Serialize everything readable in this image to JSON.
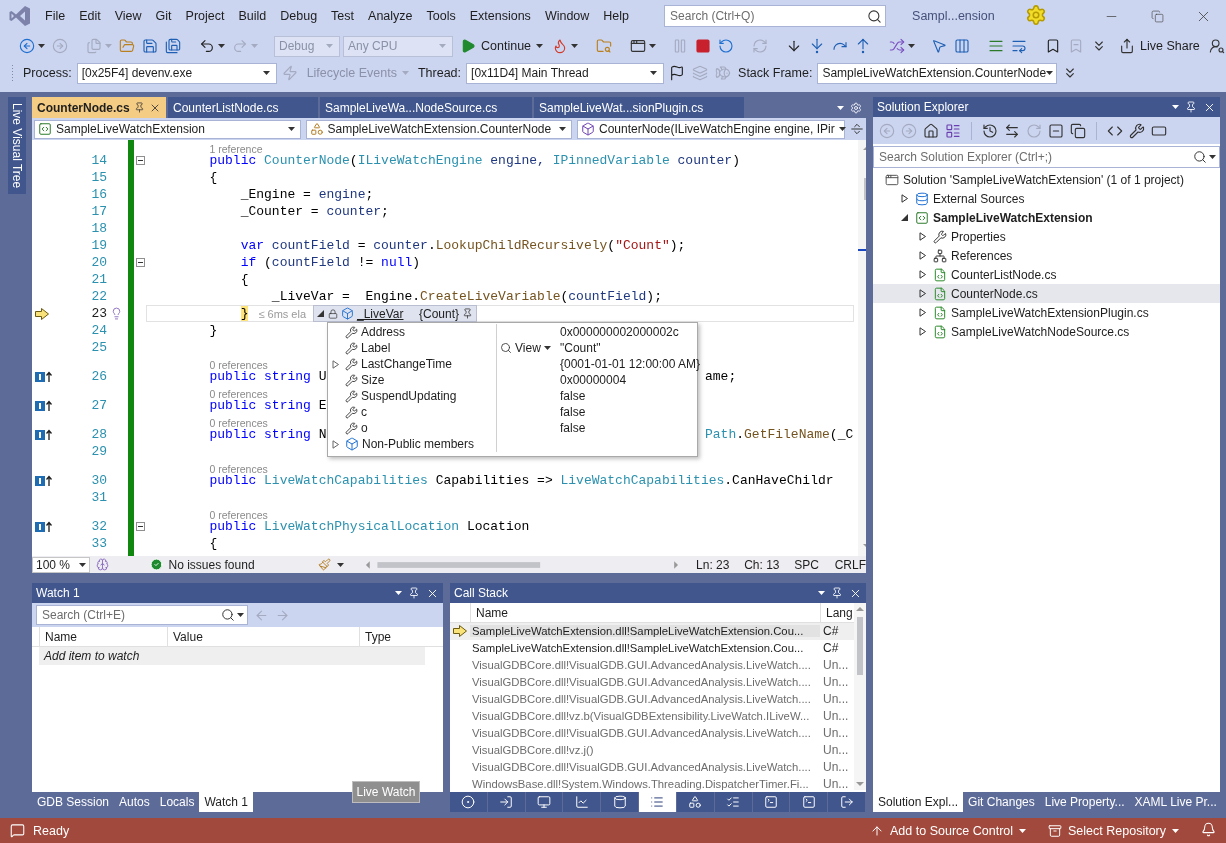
{
  "title_bar": {
    "menu": [
      "File",
      "Edit",
      "View",
      "Git",
      "Project",
      "Build",
      "Debug",
      "Test",
      "Analyze",
      "Tools",
      "Extensions",
      "Window",
      "Help"
    ],
    "search": {
      "placeholder": "Search (Ctrl+Q)"
    },
    "title": "Sampl...ension"
  },
  "toolbar": [
    {
      "kind": "back",
      "menu": true,
      "disabled": false
    },
    {
      "kind": "forward",
      "menu": false,
      "disabled": true
    },
    {
      "kind": "separator"
    },
    {
      "kind": "new",
      "menu": true,
      "disabled": true
    },
    {
      "kind": "open",
      "menu": false,
      "disabled": false
    },
    {
      "kind": "save",
      "menu": false,
      "disabled": false
    },
    {
      "kind": "save_all",
      "menu": false,
      "disabled": false
    },
    {
      "kind": "separator"
    },
    {
      "kind": "undo",
      "menu": true,
      "disabled": false
    },
    {
      "kind": "redo",
      "menu": true,
      "disabled": true
    },
    {
      "kind": "separator"
    },
    {
      "kind": "combo",
      "value": "Debug",
      "disabled": true
    },
    {
      "kind": "combo",
      "value": "Any CPU",
      "disabled": true
    },
    {
      "kind": "run_button",
      "label": "Continue",
      "menu": true,
      "disabled": false
    },
    {
      "kind": "hot_reload",
      "menu": true,
      "disabled": false
    },
    {
      "kind": "separator"
    },
    {
      "kind": "folder_search",
      "menu": false,
      "disabled": false
    },
    {
      "kind": "separator"
    },
    {
      "kind": "window_layout",
      "menu": true,
      "disabled": false
    },
    {
      "kind": "grip"
    },
    {
      "kind": "pause",
      "menu": false,
      "disabled": true
    },
    {
      "kind": "stop",
      "menu": false,
      "disabled": false
    },
    {
      "kind": "restart",
      "menu": false,
      "disabled": false
    },
    {
      "kind": "separator"
    },
    {
      "kind": "apply_changes",
      "menu": false,
      "disabled": true
    },
    {
      "kind": "separator"
    },
    {
      "kind": "show_next",
      "menu": false,
      "disabled": false
    },
    {
      "kind": "step_into",
      "menu": false,
      "disabled": false
    },
    {
      "kind": "step_over",
      "menu": false,
      "disabled": false
    },
    {
      "kind": "step_out",
      "menu": false,
      "disabled": false
    },
    {
      "kind": "separator"
    },
    {
      "kind": "shuffle",
      "menu": true,
      "disabled": false
    },
    {
      "kind": "grip"
    },
    {
      "kind": "pointer",
      "menu": false,
      "disabled": false
    },
    {
      "kind": "columns",
      "menu": false,
      "disabled": false
    },
    {
      "kind": "separator"
    },
    {
      "kind": "indent",
      "menu": false,
      "disabled": false
    },
    {
      "kind": "outdent",
      "menu": false,
      "disabled": false
    },
    {
      "kind": "separator"
    },
    {
      "kind": "bookmark",
      "menu": false,
      "disabled": false
    },
    {
      "kind": "bookmark_prev",
      "menu": false,
      "disabled": true
    },
    {
      "kind": "overflow",
      "menu": false,
      "disabled": false
    },
    {
      "kind": "spacer"
    },
    {
      "kind": "share_button",
      "label": "Live Share",
      "menu": false,
      "disabled": false
    },
    {
      "kind": "feedback",
      "menu": false,
      "disabled": false
    }
  ],
  "debug_location": [
    {
      "kind": "label",
      "text": "Process:"
    },
    {
      "kind": "combo",
      "value": "[0x25F4] devenv.exe",
      "disabled": false
    },
    {
      "kind": "lifecycle",
      "menu": false,
      "disabled": true
    },
    {
      "kind": "menu_button",
      "label": "Lifecycle Events",
      "menu": true,
      "disabled": true
    },
    {
      "kind": "label",
      "text": "Thread:"
    },
    {
      "kind": "combo",
      "value": "[0x11D4] Main Thread",
      "disabled": false
    },
    {
      "kind": "flag",
      "menu": false,
      "disabled": false
    },
    {
      "kind": "threads",
      "menu": false,
      "disabled": true
    },
    {
      "kind": "fish",
      "menu": false,
      "disabled": true
    },
    {
      "kind": "label",
      "text": "Stack Frame:"
    },
    {
      "kind": "combo",
      "value": "SampleLiveWatchExtension.CounterNode",
      "disabled": false
    },
    {
      "kind": "overflow",
      "menu": false,
      "disabled": false
    }
  ],
  "side_tabs": [
    "Live Visual Tree"
  ],
  "editor": {
    "tabs": [
      {
        "label": "CounterNode.cs",
        "selected": true
      },
      {
        "label": "CounterListNode.cs",
        "selected": false
      },
      {
        "label": "SampleLiveWa...NodeSource.cs",
        "selected": false
      },
      {
        "label": "SampleLiveWat...sionPlugin.cs",
        "selected": false
      }
    ],
    "navigation": [
      {
        "kind": "project",
        "text": "SampleLiveWatchExtension"
      },
      {
        "kind": "class",
        "text": "SampleLiveWatchExtension.CounterNode"
      },
      {
        "kind": "member",
        "text": "CounterNode(ILiveWatchEngine engine, IPir"
      }
    ],
    "lines": [
      {
        "kind": "codelens",
        "tokens": [
          {
            "kind": "lens",
            "text": "        1 reference"
          }
        ]
      },
      {
        "kind": "block_start",
        "number": "14",
        "tokens": [
          {
            "kind": "keyword",
            "text": "        public "
          },
          {
            "kind": "type",
            "text": "CounterNode"
          },
          {
            "kind": "plain",
            "text": "("
          },
          {
            "kind": "type",
            "text": "ILiveWatchEngine"
          },
          {
            "kind": "local",
            "text": " engine, "
          },
          {
            "kind": "type",
            "text": "IPinnedVariable"
          },
          {
            "kind": "local",
            "text": " counter"
          },
          {
            "kind": "plain",
            "text": ")"
          }
        ]
      },
      {
        "kind": "line",
        "number": "15",
        "tokens": [
          {
            "kind": "plain",
            "text": "        {"
          }
        ]
      },
      {
        "kind": "line",
        "number": "16",
        "tokens": [
          {
            "kind": "plain",
            "text": "            _Engine = "
          },
          {
            "kind": "local",
            "text": "engine"
          },
          {
            "kind": "plain",
            "text": ";"
          }
        ]
      },
      {
        "kind": "line",
        "number": "17",
        "tokens": [
          {
            "kind": "plain",
            "text": "            _Counter = "
          },
          {
            "kind": "local",
            "text": "counter"
          },
          {
            "kind": "plain",
            "text": ";"
          }
        ]
      },
      {
        "kind": "line",
        "number": "18"
      },
      {
        "kind": "line",
        "number": "19",
        "tokens": [
          {
            "kind": "keyword",
            "text": "            var"
          },
          {
            "kind": "local",
            "text": " countField"
          },
          {
            "kind": "plain",
            "text": " = "
          },
          {
            "kind": "local",
            "text": "counter"
          },
          {
            "kind": "plain",
            "text": "."
          },
          {
            "kind": "method",
            "text": "LookupChildRecursively"
          },
          {
            "kind": "plain",
            "text": "("
          },
          {
            "kind": "string",
            "text": "\"Count\""
          },
          {
            "kind": "plain",
            "text": ");"
          }
        ]
      },
      {
        "kind": "block_start",
        "number": "20",
        "tokens": [
          {
            "kind": "keyword",
            "text": "            if"
          },
          {
            "kind": "plain",
            "text": " ("
          },
          {
            "kind": "local",
            "text": "countField"
          },
          {
            "kind": "plain",
            "text": " != "
          },
          {
            "kind": "keyword",
            "text": "null"
          },
          {
            "kind": "plain",
            "text": ")"
          }
        ]
      },
      {
        "kind": "line",
        "number": "21",
        "tokens": [
          {
            "kind": "plain",
            "text": "            {"
          }
        ]
      },
      {
        "kind": "line",
        "number": "22",
        "tokens": [
          {
            "kind": "plain",
            "text": "                _LiveVar =  Engine."
          },
          {
            "kind": "method",
            "text": "CreateLiveVariable"
          },
          {
            "kind": "plain",
            "text": "("
          },
          {
            "kind": "local",
            "text": "countField"
          },
          {
            "kind": "plain",
            "text": ");"
          }
        ]
      },
      {
        "kind": "current_line",
        "number": "23",
        "tokens": [
          {
            "kind": "match",
            "text": "            }"
          },
          {
            "kind": "tip",
            "text": "≤ 6ms ela"
          }
        ]
      },
      {
        "kind": "line",
        "number": "24",
        "tokens": [
          {
            "kind": "plain",
            "text": "        }"
          }
        ]
      },
      {
        "kind": "line",
        "number": "25"
      },
      {
        "kind": "codelens",
        "tokens": [
          {
            "kind": "lens",
            "text": "        0 references"
          }
        ]
      },
      {
        "kind": "member",
        "number": "26",
        "tokens": [
          {
            "kind": "keyword",
            "text": "        public string"
          },
          {
            "kind": "plain",
            "text": " U"
          }
        ],
        "right_tokens": [
          {
            "kind": "plain",
            "text": "ame;"
          }
        ]
      },
      {
        "kind": "codelens",
        "tokens": [
          {
            "kind": "lens",
            "text": "        0 references"
          }
        ]
      },
      {
        "kind": "member",
        "number": "27",
        "tokens": [
          {
            "kind": "keyword",
            "text": "        public string"
          },
          {
            "kind": "plain",
            "text": " E"
          }
        ]
      },
      {
        "kind": "codelens",
        "tokens": [
          {
            "kind": "lens",
            "text": "        0 references"
          }
        ]
      },
      {
        "kind": "member",
        "number": "28",
        "tokens": [
          {
            "kind": "keyword",
            "text": "        public string"
          },
          {
            "kind": "plain",
            "text": " N"
          }
        ],
        "right_tokens": [
          {
            "kind": "type",
            "text": "Path"
          },
          {
            "kind": "plain",
            "text": "."
          },
          {
            "kind": "method",
            "text": "GetFileName"
          },
          {
            "kind": "plain",
            "text": "(_C"
          }
        ]
      },
      {
        "kind": "line",
        "number": "29"
      },
      {
        "kind": "codelens",
        "tokens": [
          {
            "kind": "lens",
            "text": "        0 references"
          }
        ]
      },
      {
        "kind": "member",
        "number": "30",
        "tokens": [
          {
            "kind": "keyword",
            "text": "        public "
          },
          {
            "kind": "type",
            "text": "LiveWatchCapabilities"
          },
          {
            "kind": "plain",
            "text": " Capabilities => "
          },
          {
            "kind": "type",
            "text": "LiveWatchCapabilities"
          },
          {
            "kind": "plain",
            "text": ".CanHaveChildr"
          }
        ]
      },
      {
        "kind": "line",
        "number": "31"
      },
      {
        "kind": "codelens",
        "tokens": [
          {
            "kind": "lens",
            "text": "        0 references"
          }
        ]
      },
      {
        "kind": "member_block",
        "number": "32",
        "tokens": [
          {
            "kind": "keyword",
            "text": "        public "
          },
          {
            "kind": "type",
            "text": "LiveWatchPhysicalLocation"
          },
          {
            "kind": "plain",
            "text": " Location"
          }
        ]
      },
      {
        "kind": "line",
        "number": "33",
        "tokens": [
          {
            "kind": "plain",
            "text": "        {"
          }
        ]
      }
    ],
    "datatip": {
      "name": "_LiveVar",
      "value": "{Count}",
      "rows": [
        {
          "kind": "property",
          "name": "Address",
          "value": "0x000000002000002c"
        },
        {
          "kind": "property",
          "name": "Label",
          "value": "\"Count\"",
          "visualizer": "View"
        },
        {
          "kind": "expandable_property",
          "name": "LastChangeTime",
          "value": "{0001-01-01 12:00:00 AM}"
        },
        {
          "kind": "property",
          "name": "Size",
          "value": "0x00000004"
        },
        {
          "kind": "property",
          "name": "SuspendUpdating",
          "value": "false"
        },
        {
          "kind": "property",
          "name": "c",
          "value": "false"
        },
        {
          "kind": "property",
          "name": "o",
          "value": "false"
        },
        {
          "kind": "members",
          "name": "Non-Public members"
        }
      ]
    },
    "status": {
      "zoom": "100 %",
      "issues": "No issues found",
      "line": "Ln: 23",
      "column": "Ch: 13",
      "whitespace": "SPC",
      "line_endings": "CRLF"
    }
  },
  "watch": {
    "title": "Watch 1",
    "search": {
      "placeholder": "Search (Ctrl+E)"
    },
    "columns": [
      "Name",
      "Value",
      "Type"
    ],
    "placeholder_row": "Add item to watch",
    "tabs": [
      {
        "label": "GDB Session",
        "selected": false
      },
      {
        "label": "Autos",
        "selected": false
      },
      {
        "label": "Locals",
        "selected": false
      },
      {
        "label": "Watch 1",
        "selected": true
      }
    ],
    "drag_preview": "Live Watch"
  },
  "call_stack": {
    "title": "Call Stack",
    "columns": [
      "Name",
      "Lang"
    ],
    "rows": [
      {
        "name": "SampleLiveWatchExtension.dll!SampleLiveWatchExtension.Cou...",
        "language": "C#",
        "current": true,
        "external": false
      },
      {
        "name": "SampleLiveWatchExtension.dll!SampleLiveWatchExtension.Cou...",
        "language": "C#",
        "current": false,
        "external": false
      },
      {
        "name": "VisualGDBCore.dll!VisualGDB.GUI.AdvancedAnalysis.LiveWatch....",
        "language": "Un...",
        "current": false,
        "external": true
      },
      {
        "name": "VisualGDBCore.dll!VisualGDB.GUI.AdvancedAnalysis.LiveWatch....",
        "language": "Un...",
        "current": false,
        "external": true
      },
      {
        "name": "VisualGDBCore.dll!VisualGDB.GUI.AdvancedAnalysis.LiveWatch....",
        "language": "Un...",
        "current": false,
        "external": true
      },
      {
        "name": "VisualGDBCore.dll!vz.b(VisualGDBExtensibility.LiveWatch.ILiveW...",
        "language": "Un...",
        "current": false,
        "external": true
      },
      {
        "name": "VisualGDBCore.dll!VisualGDB.GUI.AdvancedAnalysis.LiveWatch....",
        "language": "Un...",
        "current": false,
        "external": true
      },
      {
        "name": "VisualGDBCore.dll!vz.j()",
        "language": "Un...",
        "current": false,
        "external": true
      },
      {
        "name": "VisualGDBCore.dll!VisualGDB.GUI.AdvancedAnalysis.LiveWatch....",
        "language": "Un...",
        "current": false,
        "external": true
      },
      {
        "name": "WindowsBase.dll!System.Windows.Threading.DispatcherTimer.Fi...",
        "language": "Un...",
        "current": false,
        "external": true
      }
    ],
    "tool_tabs": [
      {
        "kind": "registers",
        "selected": false
      },
      {
        "kind": "output",
        "selected": false
      },
      {
        "kind": "screen",
        "selected": false
      },
      {
        "kind": "chart",
        "selected": false
      },
      {
        "kind": "memory",
        "selected": false
      },
      {
        "kind": "call_stack",
        "selected": true
      },
      {
        "kind": "objects",
        "selected": false
      },
      {
        "kind": "diagnostics",
        "selected": false
      },
      {
        "kind": "terminal",
        "selected": false
      },
      {
        "kind": "console",
        "selected": false
      },
      {
        "kind": "exit",
        "selected": false
      }
    ]
  },
  "solution_explorer": {
    "title": "Solution Explorer",
    "toolbar": [
      {
        "kind": "back",
        "disabled": true
      },
      {
        "kind": "forward",
        "disabled": true
      },
      {
        "kind": "home",
        "disabled": false
      },
      {
        "kind": "switch_views",
        "disabled": false
      },
      {
        "kind": "separator"
      },
      {
        "kind": "history",
        "disabled": false
      },
      {
        "kind": "sync",
        "disabled": false
      },
      {
        "kind": "refresh",
        "disabled": true
      },
      {
        "kind": "collapse_all",
        "disabled": false
      },
      {
        "kind": "show_all",
        "disabled": false
      },
      {
        "kind": "separator"
      },
      {
        "kind": "code",
        "disabled": false
      },
      {
        "kind": "properties",
        "disabled": false
      },
      {
        "kind": "preview",
        "disabled": false
      }
    ],
    "search": {
      "placeholder": "Search Solution Explorer (Ctrl+;)"
    },
    "tree": [
      {
        "label": "Solution 'SampleLiveWatchExtension' (1 of 1 project)",
        "kind": "solution",
        "selected": false,
        "children": [
          {
            "label": "External Sources",
            "kind": "external",
            "expanded": false,
            "selected": false
          },
          {
            "label": "SampleLiveWatchExtension",
            "kind": "project",
            "expanded": true,
            "selected": false,
            "children": [
              {
                "label": "Properties",
                "kind": "properties",
                "expanded": false,
                "selected": false
              },
              {
                "label": "References",
                "kind": "references",
                "expanded": false,
                "selected": false
              },
              {
                "label": "CounterListNode.cs",
                "kind": "file",
                "expanded": false,
                "selected": false
              },
              {
                "label": "CounterNode.cs",
                "kind": "file",
                "expanded": false,
                "selected": true
              },
              {
                "label": "SampleLiveWatchExtensionPlugin.cs",
                "kind": "file",
                "expanded": false,
                "selected": false
              },
              {
                "label": "SampleLiveWatchNodeSource.cs",
                "kind": "file",
                "expanded": false,
                "selected": false
              }
            ]
          }
        ]
      }
    ],
    "tabs": [
      {
        "label": "Solution Expl...",
        "selected": true
      },
      {
        "label": "Git Changes",
        "selected": false
      },
      {
        "label": "Live Property...",
        "selected": false
      },
      {
        "label": "XAML Live Pr...",
        "selected": false
      }
    ]
  },
  "status_bar": {
    "text": "Ready",
    "source_control": "Add to Source Control",
    "repository": "Select Repository"
  }
}
